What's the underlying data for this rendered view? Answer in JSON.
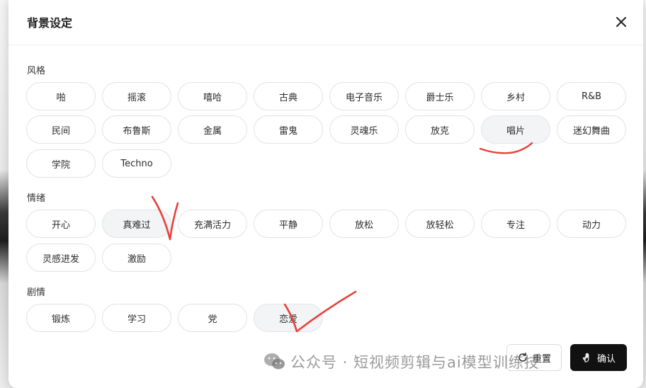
{
  "dialog": {
    "title": "背景设定",
    "close_icon": "close-icon"
  },
  "sections": [
    {
      "label": "风格",
      "rows": [
        [
          "啪",
          "摇滚",
          "嘻哈",
          "古典",
          "电子音乐",
          "爵士乐",
          "乡村",
          "R&B"
        ],
        [
          "民间",
          "布鲁斯",
          "金属",
          "雷鬼",
          "灵魂乐",
          "放克",
          "唱片",
          "迷幻舞曲"
        ],
        [
          "学院",
          "Techno"
        ]
      ],
      "selected": [
        "唱片"
      ]
    },
    {
      "label": "情绪",
      "rows": [
        [
          "开心",
          "真难过",
          "充满活力",
          "平静",
          "放松",
          "放轻松",
          "专注",
          "动力"
        ],
        [
          "灵感进发",
          "激励"
        ]
      ],
      "selected": [
        "真难过"
      ]
    },
    {
      "label": "剧情",
      "rows": [
        [
          "锻炼",
          "学习",
          "党",
          "恋爱"
        ]
      ],
      "selected": [
        "恋爱"
      ]
    }
  ],
  "footer": {
    "reset_label": "重置",
    "reset_icon": "reset-icon",
    "confirm_label": "确认",
    "confirm_icon": "hand-icon"
  },
  "watermark": {
    "text": "公众号 · 短视频剪辑与ai模型训练技",
    "icon": "wechat-icon"
  },
  "colors": {
    "annotation": "#e8413c",
    "confirm_bg": "#111111",
    "selected_chip_bg": "#f3f4f6"
  }
}
